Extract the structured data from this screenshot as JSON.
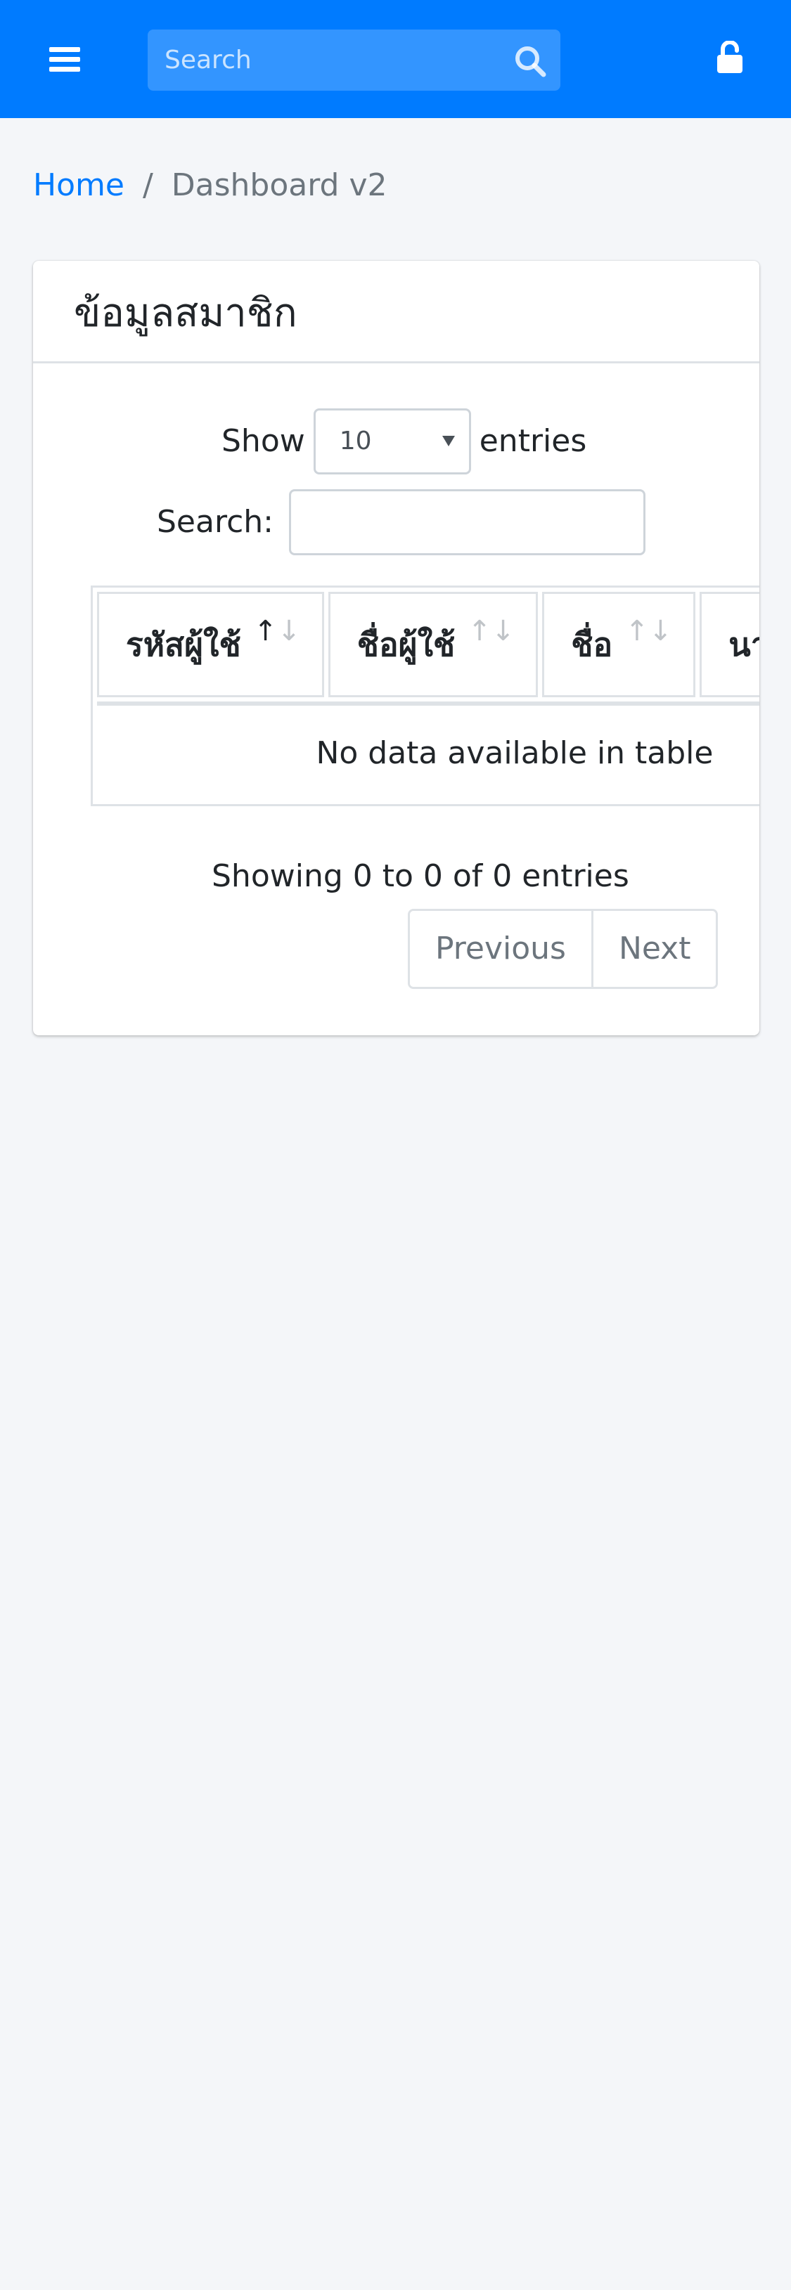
{
  "navbar": {
    "search_placeholder": "Search",
    "background_color": "#007bff",
    "icons": [
      "bars-icon",
      "search-icon",
      "unlock-icon"
    ]
  },
  "breadcrumb": {
    "home": "Home",
    "separator": "/",
    "current": "Dashboard v2"
  },
  "card": {
    "title": "ข้อมูลสมาชิก"
  },
  "datatable": {
    "length_label_before": "Show",
    "length_value": "10",
    "length_label_after": "entries",
    "search_label": "Search:",
    "search_value": "",
    "columns": [
      {
        "label": "รหัสผู้ใช้",
        "sorted": "asc"
      },
      {
        "label": "ชื่อผู้ใช้",
        "sorted": "none"
      },
      {
        "label": "ชื่อ",
        "sorted": "none"
      },
      {
        "label": "นามสกุล",
        "sorted": "none"
      }
    ],
    "sort_up": "↑",
    "sort_down": "↓",
    "empty_message": "No data available in table",
    "info": "Showing 0 to 0 of 0 entries",
    "previous": "Previous",
    "next": "Next"
  }
}
